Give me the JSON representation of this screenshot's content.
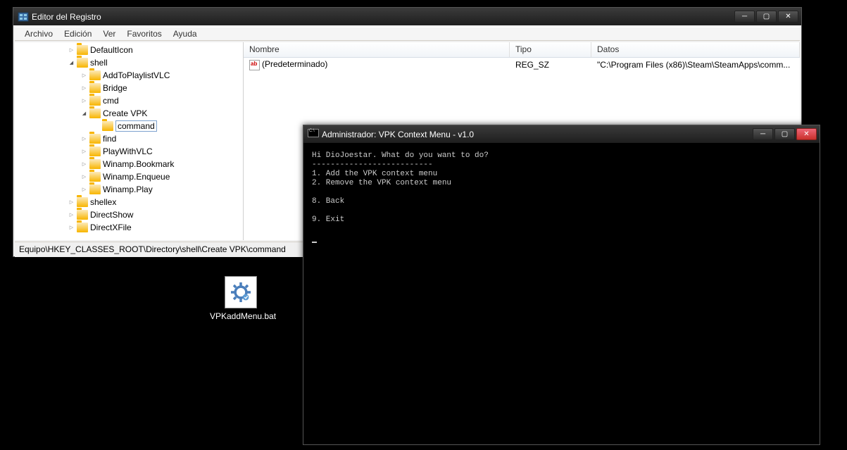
{
  "regedit": {
    "title": "Editor del Registro",
    "menu": [
      "Archivo",
      "Edición",
      "Ver",
      "Favoritos",
      "Ayuda"
    ],
    "tree": [
      {
        "label": "DefaultIcon",
        "indent": 1,
        "exp": "closed"
      },
      {
        "label": "shell",
        "indent": 1,
        "exp": "open"
      },
      {
        "label": "AddToPlaylistVLC",
        "indent": 2,
        "exp": "closed"
      },
      {
        "label": "Bridge",
        "indent": 2,
        "exp": "closed"
      },
      {
        "label": "cmd",
        "indent": 2,
        "exp": "closed"
      },
      {
        "label": "Create VPK",
        "indent": 2,
        "exp": "open"
      },
      {
        "label": "command",
        "indent": 3,
        "exp": "none",
        "selected": true
      },
      {
        "label": "find",
        "indent": 2,
        "exp": "closed"
      },
      {
        "label": "PlayWithVLC",
        "indent": 2,
        "exp": "closed"
      },
      {
        "label": "Winamp.Bookmark",
        "indent": 2,
        "exp": "closed"
      },
      {
        "label": "Winamp.Enqueue",
        "indent": 2,
        "exp": "closed"
      },
      {
        "label": "Winamp.Play",
        "indent": 2,
        "exp": "closed"
      },
      {
        "label": "shellex",
        "indent": 1,
        "exp": "closed"
      },
      {
        "label": "DirectShow",
        "indent": 0,
        "exp": "closed"
      },
      {
        "label": "DirectXFile",
        "indent": 0,
        "exp": "closed"
      }
    ],
    "columns": {
      "name": "Nombre",
      "type": "Tipo",
      "data": "Datos"
    },
    "row": {
      "name": "(Predeterminado)",
      "type": "REG_SZ",
      "data": "\"C:\\Program Files (x86)\\Steam\\SteamApps\\comm..."
    },
    "statusbar": "Equipo\\HKEY_CLASSES_ROOT\\Directory\\shell\\Create VPK\\command"
  },
  "desktop": {
    "icon_label": "VPKaddMenu.bat"
  },
  "console": {
    "title": "Administrador:  VPK Context Menu - v1.0",
    "lines": [
      "Hi DioJoestar. What do you want to do?",
      "--------------------------",
      "1. Add the VPK context menu",
      "2. Remove the VPK context menu",
      "",
      "8. Back",
      "",
      "9. Exit",
      ""
    ]
  }
}
